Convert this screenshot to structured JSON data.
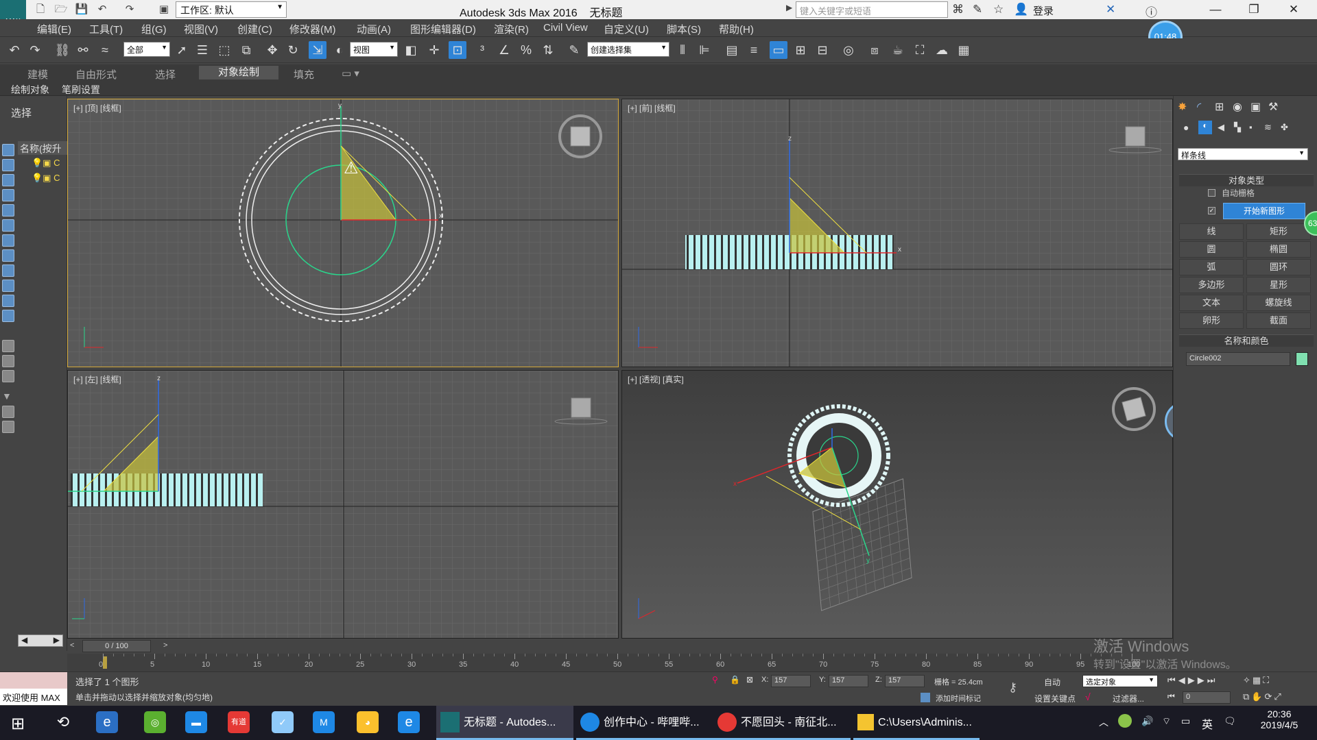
{
  "title_bar": {
    "app_title": "Autodesk 3ds Max 2016",
    "doc_title": "无标题",
    "workspace": "工作区: 默认",
    "search_placeholder": "键入关键字或短语",
    "login": "登录",
    "app_icon_label": "MAX"
  },
  "menu": [
    "编辑(E)",
    "工具(T)",
    "组(G)",
    "视图(V)",
    "创建(C)",
    "修改器(M)",
    "动画(A)",
    "图形编辑器(D)",
    "渲染(R)",
    "Civil View",
    "自定义(U)",
    "脚本(S)",
    "帮助(H)"
  ],
  "timer": "01:48",
  "toolbar": {
    "filter": "全部",
    "coord": "视图",
    "named_sel": "创建选择集"
  },
  "ribbon_tabs": [
    "建模",
    "自由形式",
    "选择",
    "对象绘制",
    "填充"
  ],
  "ribbon_active": "对象绘制",
  "ribbon_sub": [
    "绘制对象",
    "笔刷设置"
  ],
  "scene_explorer": {
    "title": "选择",
    "col_header": "名称(按升"
  },
  "viewports": [
    {
      "label": "[+] [顶] [线框]"
    },
    {
      "label": "[+] [前] [线框]"
    },
    {
      "label": "[+] [左] [线框]"
    },
    {
      "label": "[+] [透视] [真实]"
    }
  ],
  "command_panel": {
    "category": "样条线",
    "rollout_object_type": "对象类型",
    "auto_grid": "自动栅格",
    "start_new_shape": "开始新图形",
    "shapes": [
      "线",
      "矩形",
      "圆",
      "椭圆",
      "弧",
      "圆环",
      "多边形",
      "星形",
      "文本",
      "螺旋线",
      "卵形",
      "截面"
    ],
    "rollout_name_color": "名称和颜色",
    "object_name": "Circle002",
    "object_color": "#80e0b0"
  },
  "badges": {
    "green_badge": "63",
    "lang_badge": "英"
  },
  "timeline": {
    "frame": "0 / 100",
    "ticks": [
      "0",
      "5",
      "10",
      "15",
      "20",
      "25",
      "30",
      "35",
      "40",
      "45",
      "50",
      "55",
      "60",
      "65",
      "70",
      "75",
      "80",
      "85",
      "90",
      "95",
      "100"
    ]
  },
  "status": {
    "welcome": "欢迎使用 MAX",
    "selected": "选择了 1 个图形",
    "hint": "单击并拖动以选择并缩放对象(均匀地)",
    "x_label": "X:",
    "x_val": "157",
    "y_label": "Y:",
    "y_val": "157",
    "z_label": "Z:",
    "z_val": "157",
    "grid": "栅格 = 25.4cm",
    "auto": "自动",
    "sel_set": "选定对象",
    "set_key": "设置关键点",
    "filters": "过滤器...",
    "add_time_tag": "添加时间标记",
    "frame_input": "0"
  },
  "watermark": {
    "line1": "激活 Windows",
    "line2": "转到\"设置\"以激活 Windows。"
  },
  "taskbar": {
    "items": [
      "无标题 - Autodes...",
      "创作中心 - 哔哩哔...",
      "不愿回头 - 南征北...",
      "C:\\Users\\Adminis..."
    ],
    "time": "20:36",
    "date": "2019/4/5",
    "ime": "英"
  }
}
